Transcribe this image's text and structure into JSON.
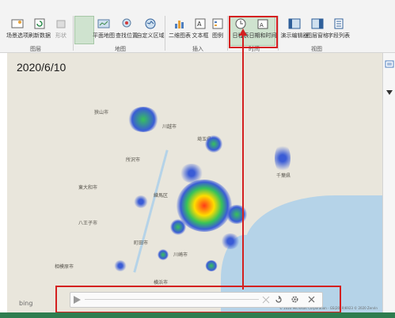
{
  "ribbon": {
    "buttons": [
      {
        "id": "scene-options",
        "label": "场景选项"
      },
      {
        "id": "refresh-data",
        "label": "刷新数据"
      },
      {
        "id": "shape",
        "label": "形状"
      },
      {
        "id": "flat-map",
        "label": "平面地图"
      },
      {
        "id": "find-location",
        "label": "查找位置"
      },
      {
        "id": "custom-region",
        "label": "自定义区域"
      },
      {
        "id": "2d-chart",
        "label": "二维图表"
      },
      {
        "id": "text-box",
        "label": "文本框"
      },
      {
        "id": "legend",
        "label": "图例"
      },
      {
        "id": "timeline",
        "label": "日程表"
      },
      {
        "id": "date-time",
        "label": "日期和时间"
      },
      {
        "id": "show-editor",
        "label": "演示编辑器"
      },
      {
        "id": "layer-pane",
        "label": "图层窗格"
      },
      {
        "id": "field-list",
        "label": "字段列表"
      }
    ],
    "groups": {
      "layer": "图层",
      "map": "地图",
      "insert": "插入",
      "time": "时间",
      "view": "视图"
    }
  },
  "map": {
    "date_label": "2020/6/10",
    "bing_logo": "bing",
    "copyright": "© 2020 Microsoft Corporation - GS(2019)6923 © 2020 Zenrin"
  },
  "player": {
    "play_icon": "play-icon",
    "close_icon": "close-icon",
    "loop_icon": "loop-icon",
    "settings_icon": "gear-icon"
  },
  "colors": {
    "annotation": "#d42020",
    "ribbon_bg": "#f3f3f3",
    "highlight": "#cfe3cf",
    "heat_hot": "#ff3a1a",
    "heat_warm": "#ffdd00",
    "heat_mid": "#37c25a",
    "heat_cool": "#3a5cd6"
  }
}
